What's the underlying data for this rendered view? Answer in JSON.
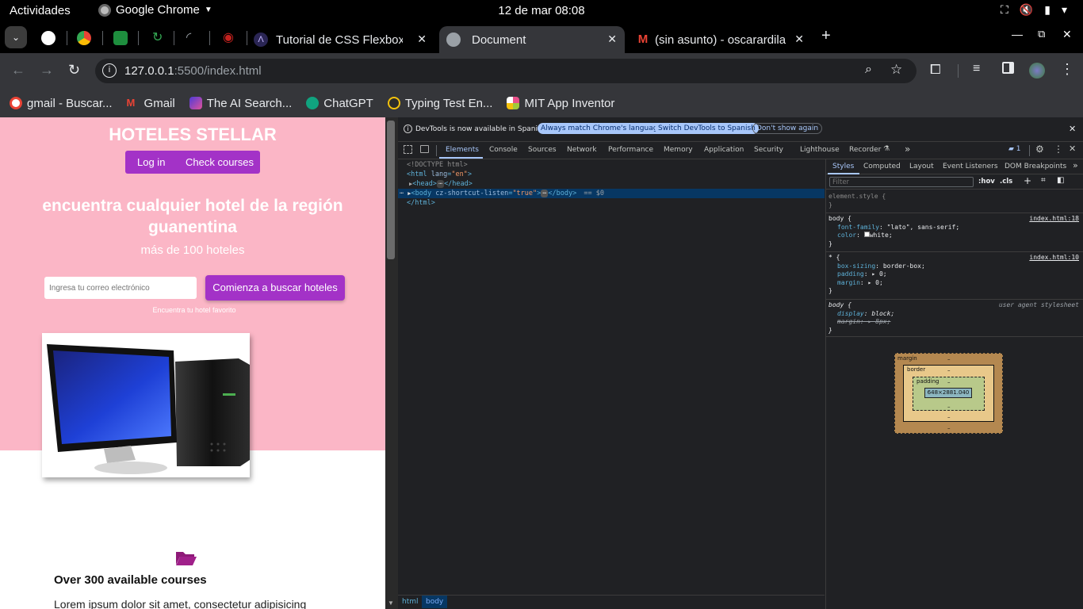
{
  "system": {
    "activities": "Actividades",
    "app_name": "Google Chrome",
    "clock": "12 de mar  08:08",
    "tray_icons": [
      "network-icon",
      "volume-icon",
      "battery-icon",
      "power-menu-icon"
    ]
  },
  "tabs": [
    {
      "title": "Tutorial de CSS Flexbox y",
      "favicon": "code-icon"
    },
    {
      "title": "Document",
      "favicon": "globe-icon"
    },
    {
      "title": "(sin asunto) - oscarardila",
      "favicon": "gmail-icon"
    }
  ],
  "address": {
    "host": "127.0.0.1",
    "path": ":5500/index.html"
  },
  "bookmarks": [
    {
      "label": "gmail - Buscar...",
      "icon": "google-icon",
      "color": "#ea4335"
    },
    {
      "label": "Gmail",
      "icon": "gmail-icon",
      "color": "#ea4335"
    },
    {
      "label": "The AI Search...",
      "icon": "ai-search-icon",
      "color": "#7b4bde"
    },
    {
      "label": "ChatGPT",
      "icon": "chatgpt-icon",
      "color": "#10a37f"
    },
    {
      "label": "Typing Test En...",
      "icon": "typing-test-icon",
      "color": "#f4c20d"
    },
    {
      "label": "MIT App Inventor",
      "icon": "app-inventor-icon",
      "color": "#a0c93b"
    }
  ],
  "site": {
    "brand": "HOTELES STELLAR",
    "nav": [
      "Log in",
      "Check courses"
    ],
    "headline": "encuentra cualquier hotel de la región guanentina",
    "subheadline": "más de 100 hoteles",
    "email_placeholder": "Ingresa tu correo electrónico",
    "cta": "Comienza a buscar hoteles",
    "hint": "Encuentra tu hotel favorito",
    "feature_title": "Over 300 available courses",
    "feature_text": "Lorem ipsum dolor sit amet, consectetur adipisicing",
    "colors": {
      "hero_bg": "#fbb6c6",
      "accent": "#a332c7"
    }
  },
  "devtools": {
    "notice": "DevTools is now available in Spanish!",
    "notice_buttons": [
      "Always match Chrome's language",
      "Switch DevTools to Spanish",
      "Don't show again"
    ],
    "tabs": [
      "Elements",
      "Console",
      "Sources",
      "Network",
      "Performance",
      "Memory",
      "Application",
      "Security",
      "Lighthouse",
      "Recorder"
    ],
    "issues_count": "1",
    "dom": {
      "doctype": "<!DOCTYPE html>",
      "html_open": "<html lang=\"en\">",
      "head": "<head>",
      "head_close": "</head>",
      "body_tag": "<body cz-shortcut-listen=\"true\">",
      "body_close": "</body>",
      "selected_marker": "== $0",
      "html_close": "</html>"
    },
    "breadcrumbs": [
      "html",
      "body"
    ],
    "side_tabs": [
      "Styles",
      "Computed",
      "Layout",
      "Event Listeners",
      "DOM Breakpoints"
    ],
    "filter_placeholder": "Filter",
    "filter_tools": [
      ":hov",
      ".cls"
    ],
    "rules": {
      "element_style": "element.style {",
      "body_selector": "body {",
      "body_source": "index.html:18",
      "body_font": "\"lato\", sans-serif;",
      "body_color": "white;",
      "star_selector": "* {",
      "star_source": "index.html:10",
      "star_box_sizing": "border-box;",
      "star_padding": "0;",
      "star_margin": "0;",
      "ua_selector": "body {",
      "ua_source": "user agent stylesheet",
      "ua_display": "block;",
      "ua_margin": "8px;"
    },
    "box_model": {
      "margin": "margin",
      "border": "border",
      "padding": "padding",
      "content": "648×2881.040",
      "dash": "–"
    }
  }
}
